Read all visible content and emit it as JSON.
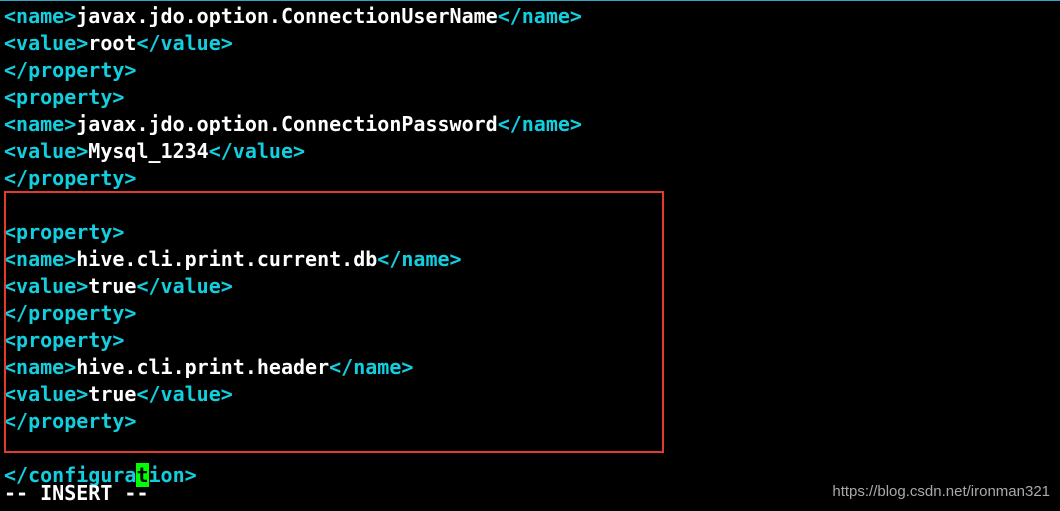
{
  "editor": {
    "lines": [
      {
        "segments": [
          {
            "cls": "tag",
            "t": "<name>"
          },
          {
            "cls": "txt",
            "t": "javax.jdo.option.ConnectionUserName"
          },
          {
            "cls": "tag",
            "t": "</name>"
          }
        ]
      },
      {
        "segments": [
          {
            "cls": "tag",
            "t": "<value>"
          },
          {
            "cls": "txt",
            "t": "root"
          },
          {
            "cls": "tag",
            "t": "</value>"
          }
        ]
      },
      {
        "segments": [
          {
            "cls": "tag",
            "t": "</property>"
          }
        ]
      },
      {
        "segments": [
          {
            "cls": "tag",
            "t": "<property>"
          }
        ]
      },
      {
        "segments": [
          {
            "cls": "tag",
            "t": "<name>"
          },
          {
            "cls": "txt",
            "t": "javax.jdo.option.ConnectionPassword"
          },
          {
            "cls": "tag",
            "t": "</name>"
          }
        ]
      },
      {
        "segments": [
          {
            "cls": "tag",
            "t": "<value>"
          },
          {
            "cls": "txt",
            "t": "Mysql_1234"
          },
          {
            "cls": "tag",
            "t": "</value>"
          }
        ]
      },
      {
        "segments": [
          {
            "cls": "tag",
            "t": "</property>"
          }
        ]
      },
      {
        "segments": []
      },
      {
        "segments": [
          {
            "cls": "tag",
            "t": "<property>"
          }
        ]
      },
      {
        "segments": [
          {
            "cls": "tag",
            "t": "<name>"
          },
          {
            "cls": "txt",
            "t": "hive.cli.print.current.db"
          },
          {
            "cls": "tag",
            "t": "</name>"
          }
        ]
      },
      {
        "segments": [
          {
            "cls": "tag",
            "t": "<value>"
          },
          {
            "cls": "txt",
            "t": "true"
          },
          {
            "cls": "tag",
            "t": "</value>"
          }
        ]
      },
      {
        "segments": [
          {
            "cls": "tag",
            "t": "</property>"
          }
        ]
      },
      {
        "segments": [
          {
            "cls": "tag",
            "t": "<property>"
          }
        ]
      },
      {
        "segments": [
          {
            "cls": "tag",
            "t": "<name>"
          },
          {
            "cls": "txt",
            "t": "hive.cli.print.header"
          },
          {
            "cls": "tag",
            "t": "</name>"
          }
        ]
      },
      {
        "segments": [
          {
            "cls": "tag",
            "t": "<value>"
          },
          {
            "cls": "txt",
            "t": "true"
          },
          {
            "cls": "tag",
            "t": "</value>"
          }
        ]
      },
      {
        "segments": [
          {
            "cls": "tag",
            "t": "</property>"
          }
        ]
      },
      {
        "segments": []
      },
      {
        "segments": [
          {
            "cls": "tag",
            "t": "</configura"
          },
          {
            "cls": "tag",
            "cursor": true,
            "t": "t"
          },
          {
            "cls": "tag",
            "t": "ion>"
          }
        ]
      }
    ]
  },
  "status_line": "-- INSERT --",
  "watermark": "https://blog.csdn.net/ironman321"
}
